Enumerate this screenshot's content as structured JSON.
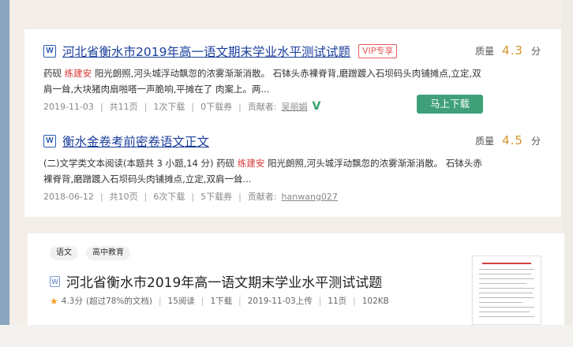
{
  "results": [
    {
      "title": "河北省衡水市2019年高一语文期末学业水平测试试题",
      "vip_badge": "VIP专享",
      "quality_label": "质量",
      "quality_score": "4.3",
      "quality_unit": "分",
      "snippet_pre": "药砚",
      "snippet_hl": "练建安",
      "snippet_post": "阳光朗照,河头城浮动飘忽的浓雾渐渐消散。 石钵头赤裸脊背,磨蹭踱入石坝码头肉铺摊点,立定,双肩一耸,大块猪肉扇啪嗒一声脆响,平摊在了 肉案上。两...",
      "date": "2019-11-03",
      "pages": "共11页",
      "downloads": "1次下载",
      "coupons": "0下载券",
      "contributor_label": "贡献者:",
      "contributor": "吴丽娟",
      "download_button": "马上下载"
    },
    {
      "title": "衡水金卷考前密卷语文正文",
      "quality_label": "质量",
      "quality_score": "4.5",
      "quality_unit": "分",
      "snippet_pre": "(二)文学类文本阅读(本题共 3 小题,14 分) 药砚",
      "snippet_hl": "练建安",
      "snippet_post": "阳光朗照,河头城浮动飘忽的浓雾渐渐消散。 石钵头赤裸脊背,磨蹭踱入石坝码头肉铺摊点,立定,双肩一耸...",
      "date": "2018-06-12",
      "pages": "共10页",
      "downloads": "6次下载",
      "coupons": "5下载券",
      "contributor_label": "贡献者:",
      "contributor": "hanwang027"
    }
  ],
  "detail": {
    "tags": [
      "语文",
      "高中教育"
    ],
    "title": "河北省衡水市2019年高一语文期末学业水平测试试题",
    "rating": "4.3分",
    "rating_note": "(超过78%的文档)",
    "reads": "15阅读",
    "downloads": "1下载",
    "upload_date": "2019-11-03上传",
    "pages": "11页",
    "size": "102KB"
  },
  "icons": {
    "doc": "W",
    "check": "V",
    "star": "★"
  },
  "colors": {
    "link": "#1a3e9c",
    "highlight": "#d63232",
    "score": "#d4932b",
    "button": "#3fa07a"
  }
}
